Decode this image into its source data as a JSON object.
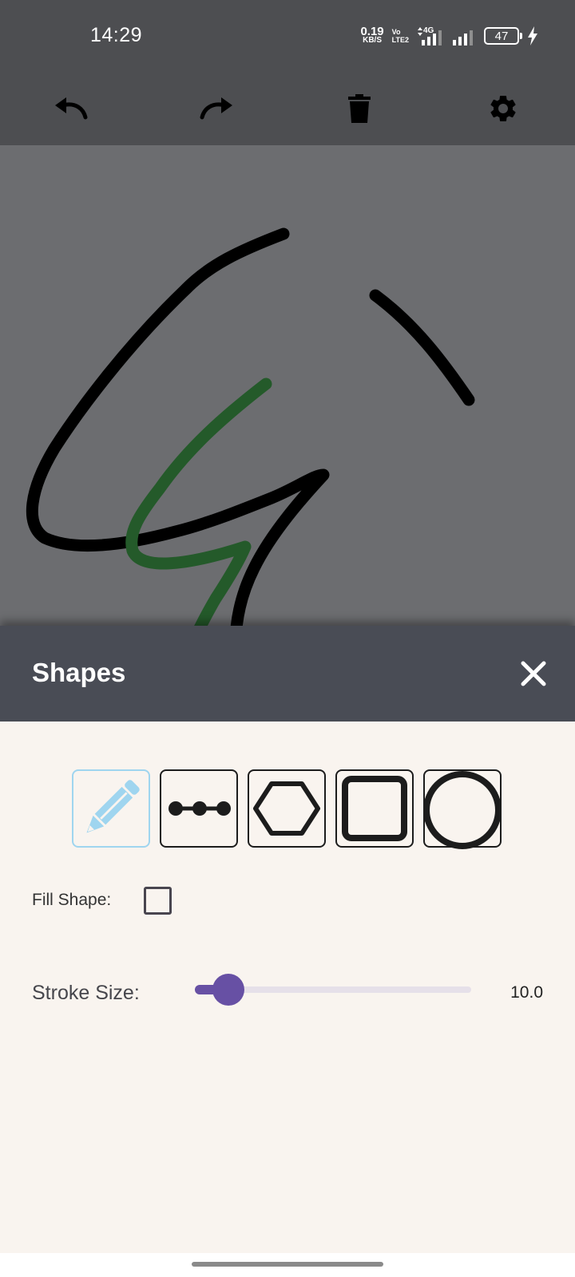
{
  "status_bar": {
    "time": "14:29",
    "net_speed_value": "0.19",
    "net_speed_unit": "KB/S",
    "volte_top": "Vo",
    "volte_bottom": "LTE2",
    "network_type": "4G",
    "battery_level": "47"
  },
  "toolbar": {
    "icons": [
      "undo-icon",
      "redo-icon",
      "trash-icon",
      "gear-icon"
    ]
  },
  "canvas": {
    "strokes": [
      {
        "color": "#000000"
      },
      {
        "color": "#000000"
      },
      {
        "color": "#000000"
      },
      {
        "color": "#245a2a"
      }
    ]
  },
  "sheet": {
    "title": "Shapes",
    "shapes": [
      {
        "icon": "pencil-icon",
        "selected": true
      },
      {
        "icon": "line-icon",
        "selected": false
      },
      {
        "icon": "hexagon-icon",
        "selected": false
      },
      {
        "icon": "square-icon",
        "selected": false
      },
      {
        "icon": "circle-icon",
        "selected": false
      }
    ],
    "fill_label": "Fill Shape:",
    "fill_checked": false,
    "stroke_label": "Stroke Size:",
    "stroke_value": "10.0",
    "stroke_fraction": 0.12
  },
  "colors": {
    "accent": "#6750a4",
    "selected_shape": "#9fd5ef",
    "header_bg": "#494c55",
    "canvas_bg": "#6c6d70"
  }
}
